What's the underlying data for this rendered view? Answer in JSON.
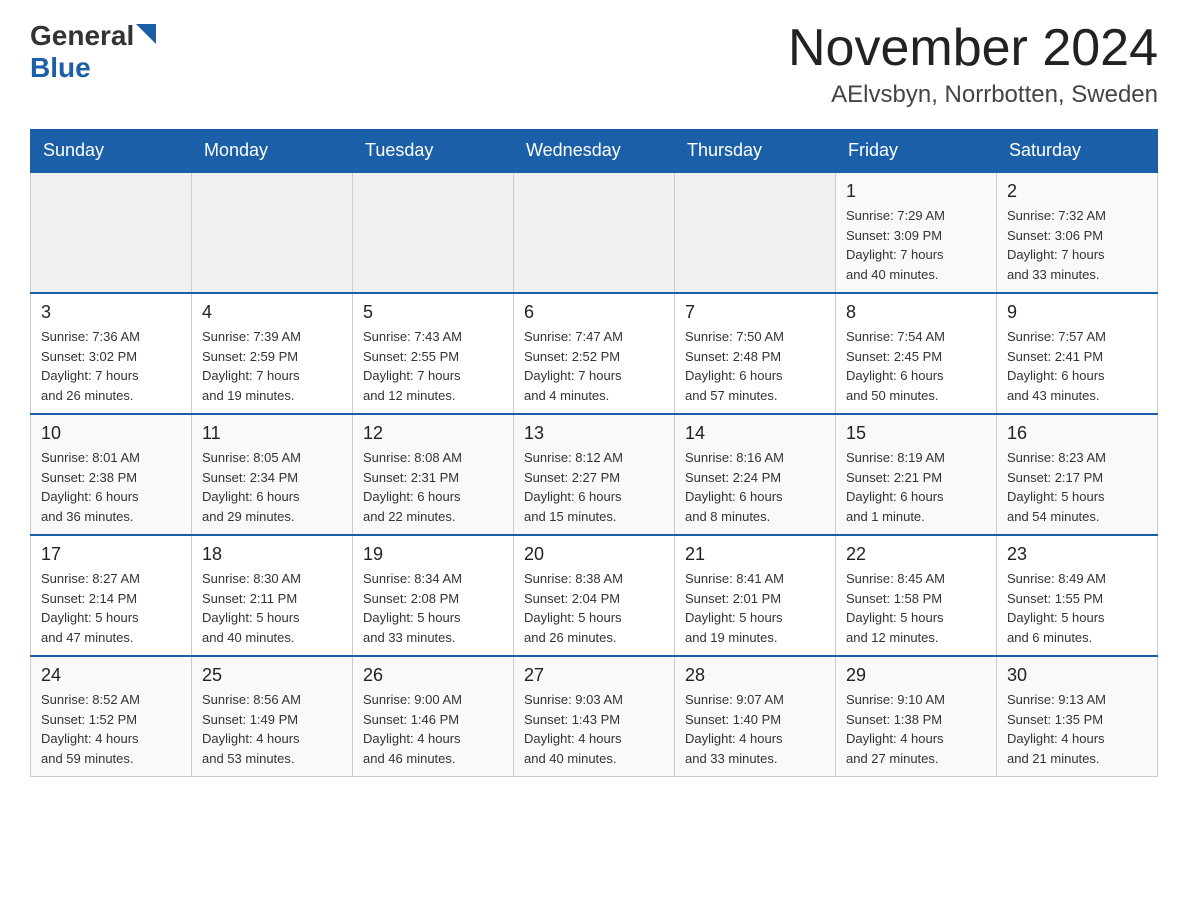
{
  "header": {
    "logo_general": "General",
    "logo_blue": "Blue",
    "month_title": "November 2024",
    "location": "AElvsbyn, Norrbotten, Sweden"
  },
  "weekdays": [
    "Sunday",
    "Monday",
    "Tuesday",
    "Wednesday",
    "Thursday",
    "Friday",
    "Saturday"
  ],
  "weeks": [
    [
      {
        "day": "",
        "info": ""
      },
      {
        "day": "",
        "info": ""
      },
      {
        "day": "",
        "info": ""
      },
      {
        "day": "",
        "info": ""
      },
      {
        "day": "",
        "info": ""
      },
      {
        "day": "1",
        "info": "Sunrise: 7:29 AM\nSunset: 3:09 PM\nDaylight: 7 hours\nand 40 minutes."
      },
      {
        "day": "2",
        "info": "Sunrise: 7:32 AM\nSunset: 3:06 PM\nDaylight: 7 hours\nand 33 minutes."
      }
    ],
    [
      {
        "day": "3",
        "info": "Sunrise: 7:36 AM\nSunset: 3:02 PM\nDaylight: 7 hours\nand 26 minutes."
      },
      {
        "day": "4",
        "info": "Sunrise: 7:39 AM\nSunset: 2:59 PM\nDaylight: 7 hours\nand 19 minutes."
      },
      {
        "day": "5",
        "info": "Sunrise: 7:43 AM\nSunset: 2:55 PM\nDaylight: 7 hours\nand 12 minutes."
      },
      {
        "day": "6",
        "info": "Sunrise: 7:47 AM\nSunset: 2:52 PM\nDaylight: 7 hours\nand 4 minutes."
      },
      {
        "day": "7",
        "info": "Sunrise: 7:50 AM\nSunset: 2:48 PM\nDaylight: 6 hours\nand 57 minutes."
      },
      {
        "day": "8",
        "info": "Sunrise: 7:54 AM\nSunset: 2:45 PM\nDaylight: 6 hours\nand 50 minutes."
      },
      {
        "day": "9",
        "info": "Sunrise: 7:57 AM\nSunset: 2:41 PM\nDaylight: 6 hours\nand 43 minutes."
      }
    ],
    [
      {
        "day": "10",
        "info": "Sunrise: 8:01 AM\nSunset: 2:38 PM\nDaylight: 6 hours\nand 36 minutes."
      },
      {
        "day": "11",
        "info": "Sunrise: 8:05 AM\nSunset: 2:34 PM\nDaylight: 6 hours\nand 29 minutes."
      },
      {
        "day": "12",
        "info": "Sunrise: 8:08 AM\nSunset: 2:31 PM\nDaylight: 6 hours\nand 22 minutes."
      },
      {
        "day": "13",
        "info": "Sunrise: 8:12 AM\nSunset: 2:27 PM\nDaylight: 6 hours\nand 15 minutes."
      },
      {
        "day": "14",
        "info": "Sunrise: 8:16 AM\nSunset: 2:24 PM\nDaylight: 6 hours\nand 8 minutes."
      },
      {
        "day": "15",
        "info": "Sunrise: 8:19 AM\nSunset: 2:21 PM\nDaylight: 6 hours\nand 1 minute."
      },
      {
        "day": "16",
        "info": "Sunrise: 8:23 AM\nSunset: 2:17 PM\nDaylight: 5 hours\nand 54 minutes."
      }
    ],
    [
      {
        "day": "17",
        "info": "Sunrise: 8:27 AM\nSunset: 2:14 PM\nDaylight: 5 hours\nand 47 minutes."
      },
      {
        "day": "18",
        "info": "Sunrise: 8:30 AM\nSunset: 2:11 PM\nDaylight: 5 hours\nand 40 minutes."
      },
      {
        "day": "19",
        "info": "Sunrise: 8:34 AM\nSunset: 2:08 PM\nDaylight: 5 hours\nand 33 minutes."
      },
      {
        "day": "20",
        "info": "Sunrise: 8:38 AM\nSunset: 2:04 PM\nDaylight: 5 hours\nand 26 minutes."
      },
      {
        "day": "21",
        "info": "Sunrise: 8:41 AM\nSunset: 2:01 PM\nDaylight: 5 hours\nand 19 minutes."
      },
      {
        "day": "22",
        "info": "Sunrise: 8:45 AM\nSunset: 1:58 PM\nDaylight: 5 hours\nand 12 minutes."
      },
      {
        "day": "23",
        "info": "Sunrise: 8:49 AM\nSunset: 1:55 PM\nDaylight: 5 hours\nand 6 minutes."
      }
    ],
    [
      {
        "day": "24",
        "info": "Sunrise: 8:52 AM\nSunset: 1:52 PM\nDaylight: 4 hours\nand 59 minutes."
      },
      {
        "day": "25",
        "info": "Sunrise: 8:56 AM\nSunset: 1:49 PM\nDaylight: 4 hours\nand 53 minutes."
      },
      {
        "day": "26",
        "info": "Sunrise: 9:00 AM\nSunset: 1:46 PM\nDaylight: 4 hours\nand 46 minutes."
      },
      {
        "day": "27",
        "info": "Sunrise: 9:03 AM\nSunset: 1:43 PM\nDaylight: 4 hours\nand 40 minutes."
      },
      {
        "day": "28",
        "info": "Sunrise: 9:07 AM\nSunset: 1:40 PM\nDaylight: 4 hours\nand 33 minutes."
      },
      {
        "day": "29",
        "info": "Sunrise: 9:10 AM\nSunset: 1:38 PM\nDaylight: 4 hours\nand 27 minutes."
      },
      {
        "day": "30",
        "info": "Sunrise: 9:13 AM\nSunset: 1:35 PM\nDaylight: 4 hours\nand 21 minutes."
      }
    ]
  ]
}
